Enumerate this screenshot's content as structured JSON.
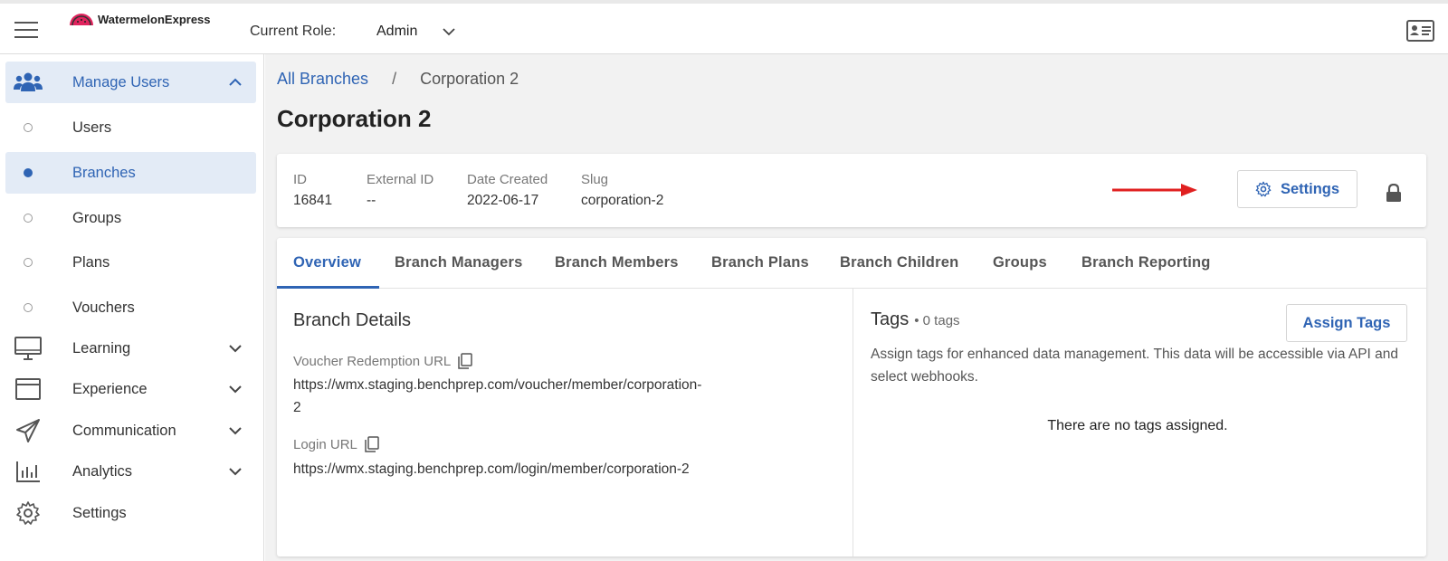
{
  "header": {
    "logo_text": "WatermelonExpress",
    "role_label": "Current Role:",
    "role_value": "Admin"
  },
  "sidebar": {
    "items": [
      {
        "label": "Manage Users",
        "icon": "users-icon"
      },
      {
        "label": "Users"
      },
      {
        "label": "Branches"
      },
      {
        "label": "Groups"
      },
      {
        "label": "Plans"
      },
      {
        "label": "Vouchers"
      },
      {
        "label": "Learning",
        "icon": "monitor-icon"
      },
      {
        "label": "Experience",
        "icon": "window-icon"
      },
      {
        "label": "Communication",
        "icon": "paper-plane-icon"
      },
      {
        "label": "Analytics",
        "icon": "bar-chart-icon"
      },
      {
        "label": "Settings",
        "icon": "gear-icon"
      }
    ]
  },
  "breadcrumb": {
    "link": "All Branches",
    "separator": "/",
    "current": "Corporation 2"
  },
  "page_title": "Corporation 2",
  "info": {
    "id_label": "ID",
    "id_value": "16841",
    "external_id_label": "External ID",
    "external_id_value": "--",
    "date_created_label": "Date Created",
    "date_created_value": "2022-06-17",
    "slug_label": "Slug",
    "slug_value": "corporation-2",
    "settings_label": "Settings"
  },
  "tabs": [
    "Overview",
    "Branch Managers",
    "Branch Members",
    "Branch Plans",
    "Branch Children",
    "Groups",
    "Branch Reporting"
  ],
  "details": {
    "title": "Branch Details",
    "voucher_label": "Voucher Redemption URL",
    "voucher_line1": "https://wmx.staging.benchprep.com/voucher/member/corporation-",
    "voucher_line2": "2",
    "login_label": "Login URL",
    "login_value": "https://wmx.staging.benchprep.com/login/member/corporation-2"
  },
  "tags": {
    "title": "Tags",
    "count": "• 0 tags",
    "assign_label": "Assign Tags",
    "description": "Assign tags for enhanced data management. This data will be accessible via API and select webhooks.",
    "empty_message": "There are no tags assigned."
  },
  "colors": {
    "accent": "#2f64b4",
    "active_bg": "#e3ebf6",
    "arrow": "#e02020"
  }
}
